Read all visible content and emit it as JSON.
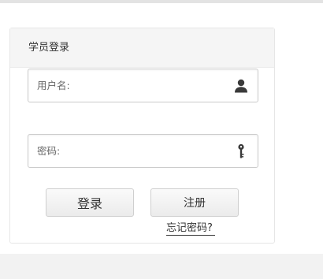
{
  "login": {
    "title": "学员登录",
    "username": {
      "placeholder": "用户名:",
      "value": "",
      "icon": "user-icon"
    },
    "password": {
      "placeholder": "密码:",
      "value": "",
      "icon": "key-icon"
    },
    "login_label": "登录",
    "register_label": "注册",
    "forgot_label": "忘记密码?"
  }
}
